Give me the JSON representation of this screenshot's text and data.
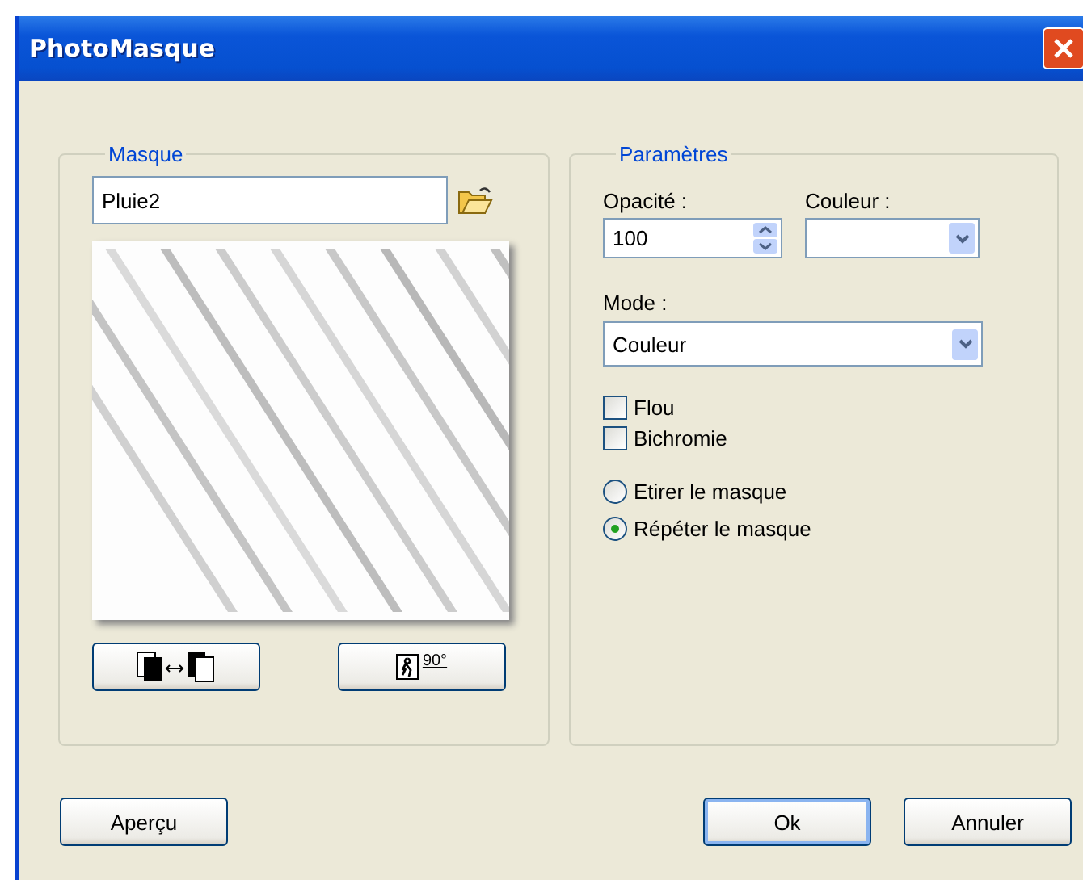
{
  "window": {
    "title": "PhotoMasque"
  },
  "mask": {
    "legend": "Masque",
    "name_field": {
      "value": "Pluie2"
    },
    "rotate_label": "90°"
  },
  "parameters": {
    "legend": "Paramètres",
    "opacity": {
      "label": "Opacité :",
      "value": "100"
    },
    "color": {
      "label": "Couleur :"
    },
    "mode": {
      "label": "Mode :",
      "value": "Couleur"
    },
    "checkboxes": [
      {
        "label": "Flou",
        "checked": false
      },
      {
        "label": "Bichromie",
        "checked": false
      }
    ],
    "radios": [
      {
        "label": "Etirer le masque",
        "selected": false
      },
      {
        "label": "Répéter le masque",
        "selected": true
      }
    ]
  },
  "buttons": [
    {
      "label": "Aperçu",
      "default": false
    },
    {
      "label": "Ok",
      "default": true
    },
    {
      "label": "Annuler",
      "default": false
    }
  ]
}
